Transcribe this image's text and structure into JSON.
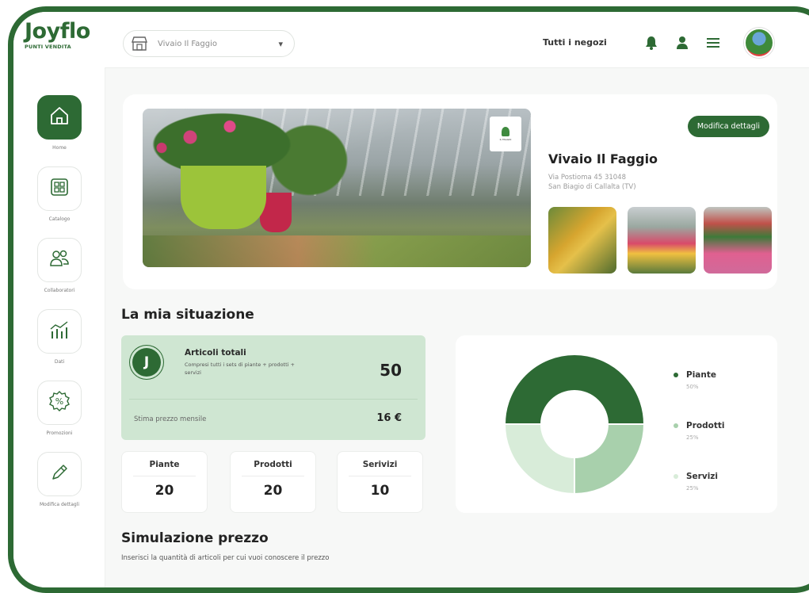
{
  "app": {
    "logo": "Joyflo",
    "logo_sub": "PUNTI VENDITA",
    "store_selector": "Vivaio Il Faggio",
    "all_stores": "Tutti i negozi"
  },
  "sidebar": {
    "items": [
      {
        "label": "Home",
        "icon": "home-icon"
      },
      {
        "label": "Catalogo",
        "icon": "catalog-icon"
      },
      {
        "label": "Collaboratori",
        "icon": "people-icon"
      },
      {
        "label": "Dati",
        "icon": "chart-icon"
      },
      {
        "label": "Promozioni",
        "icon": "discount-icon"
      },
      {
        "label": "Modifica dettagli",
        "icon": "pencil-icon"
      }
    ]
  },
  "store": {
    "edit_button": "Modifica dettagli",
    "name": "Vivaio Il Faggio",
    "address_line1": "Via Postioma 45 31048",
    "address_line2": "San Biagio di Callalta (TV)",
    "hero_badge": "IL FAGGIO"
  },
  "situation": {
    "title": "La mia situazione",
    "badge": "J",
    "total_title": "Articoli totali",
    "total_sub": "Compresi tutti i sets di piante + prodotti + servizi",
    "total_value": "50",
    "estimate_label": "Stima prezzo mensile",
    "estimate_value": "16 €",
    "counts": [
      {
        "label": "Piante",
        "value": "20"
      },
      {
        "label": "Prodotti",
        "value": "20"
      },
      {
        "label": "Serivizi",
        "value": "10"
      }
    ]
  },
  "chart_data": {
    "type": "pie",
    "categories": [
      "Piante",
      "Prodotti",
      "Servizi"
    ],
    "values": [
      50,
      25,
      25
    ],
    "labels": [
      "50%",
      "25%",
      "25%"
    ],
    "colors": [
      "#2d6a34",
      "#a8d0ac",
      "#d8ecd9"
    ],
    "legend": "right",
    "title": ""
  },
  "simulation": {
    "title": "Simulazione prezzo",
    "subtitle": "Inserisci la quantità di articoli per cui vuoi conoscere il prezzo"
  },
  "colors": {
    "primary": "#2d6a34",
    "soft": "#cfe6d2"
  }
}
